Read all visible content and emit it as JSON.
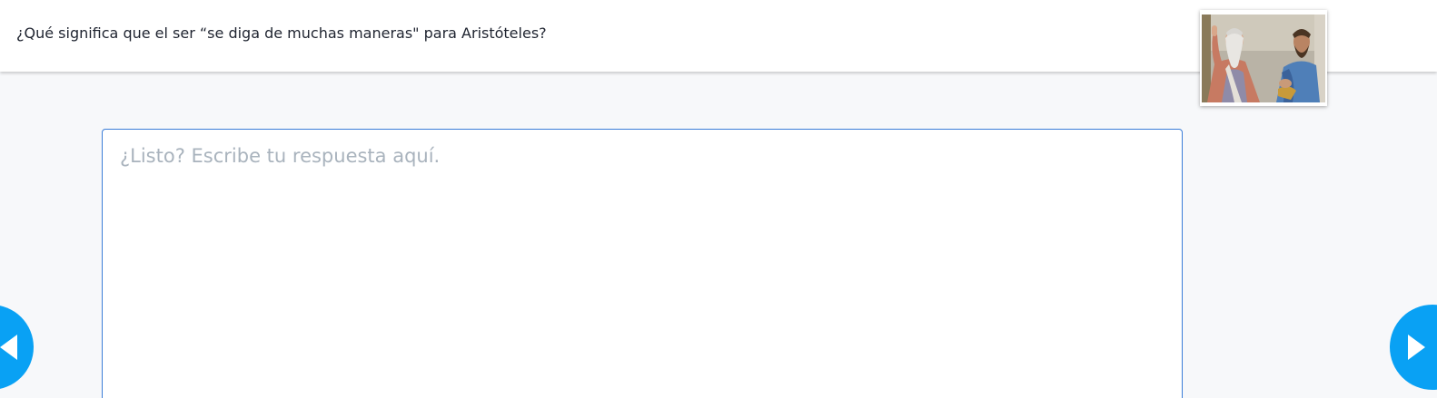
{
  "header": {
    "question": "¿Qué significa que el ser “se diga de muchas maneras\" para Aristóteles?",
    "avatar_icon": "philosophers-painting-icon"
  },
  "answer": {
    "placeholder": "¿Listo? Escribe tu respuesta aquí.",
    "value": ""
  },
  "navigation": {
    "prev_icon": "triangle-left-icon",
    "next_icon": "triangle-right-icon"
  },
  "colors": {
    "background": "#f7f8fa",
    "accent": "#09a1f4",
    "input_border": "#3b7dd8",
    "placeholder": "#a9b3bd",
    "text": "#1f2430"
  }
}
